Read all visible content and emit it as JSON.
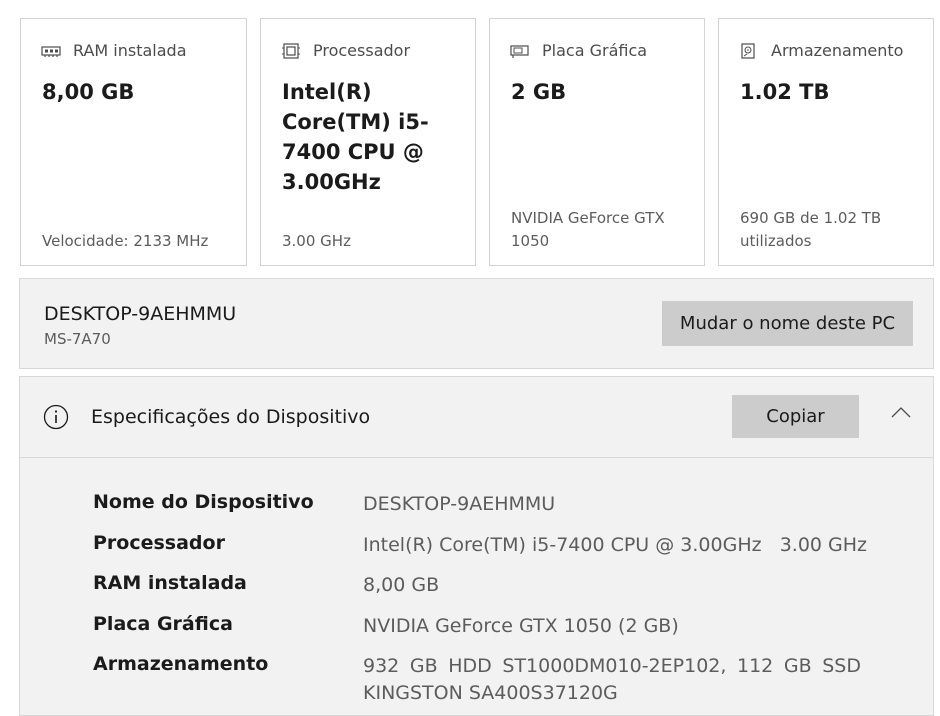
{
  "cards": [
    {
      "icon": "ram-icon",
      "title": "RAM instalada",
      "value": "8,00 GB",
      "detail": "Velocidade: 2133 MHz"
    },
    {
      "icon": "processor-icon",
      "title": "Processador",
      "value": "Intel(R) Core(TM) i5-7400 CPU @ 3.00GHz",
      "detail": "3.00 GHz"
    },
    {
      "icon": "graphics-card-icon",
      "title": "Placa Gráfica",
      "value": "2 GB",
      "detail": "NVIDIA GeForce GTX 1050"
    },
    {
      "icon": "storage-icon",
      "title": "Armazenamento",
      "value": "1.02 TB",
      "detail": "690 GB de 1.02 TB utilizados"
    }
  ],
  "pc": {
    "name": "DESKTOP-9AEHMMU",
    "model": "MS-7A70",
    "rename_label": "Mudar o nome deste PC"
  },
  "specs": {
    "title": "Especificações do Dispositivo",
    "copy_label": "Copiar",
    "rows": [
      {
        "label": "Nome do Dispositivo",
        "value": "DESKTOP-9AEHMMU"
      },
      {
        "label": "Processador",
        "value": "Intel(R) Core(TM) i5-7400 CPU @ 3.00GHz   3.00 GHz"
      },
      {
        "label": "RAM instalada",
        "value": "8,00 GB"
      },
      {
        "label": "Placa Gráfica",
        "value": "NVIDIA GeForce GTX 1050 (2 GB)"
      },
      {
        "label": "Armazenamento",
        "value": "932 GB HDD ST1000DM010-2EP102, 112 GB SSD KINGSTON SA400S37120G"
      }
    ]
  },
  "colors": {
    "panel_background": "#f2f2f2",
    "button_background": "#cccccc",
    "border": "#d3d3d3",
    "secondary_text": "#5c5c5c"
  }
}
